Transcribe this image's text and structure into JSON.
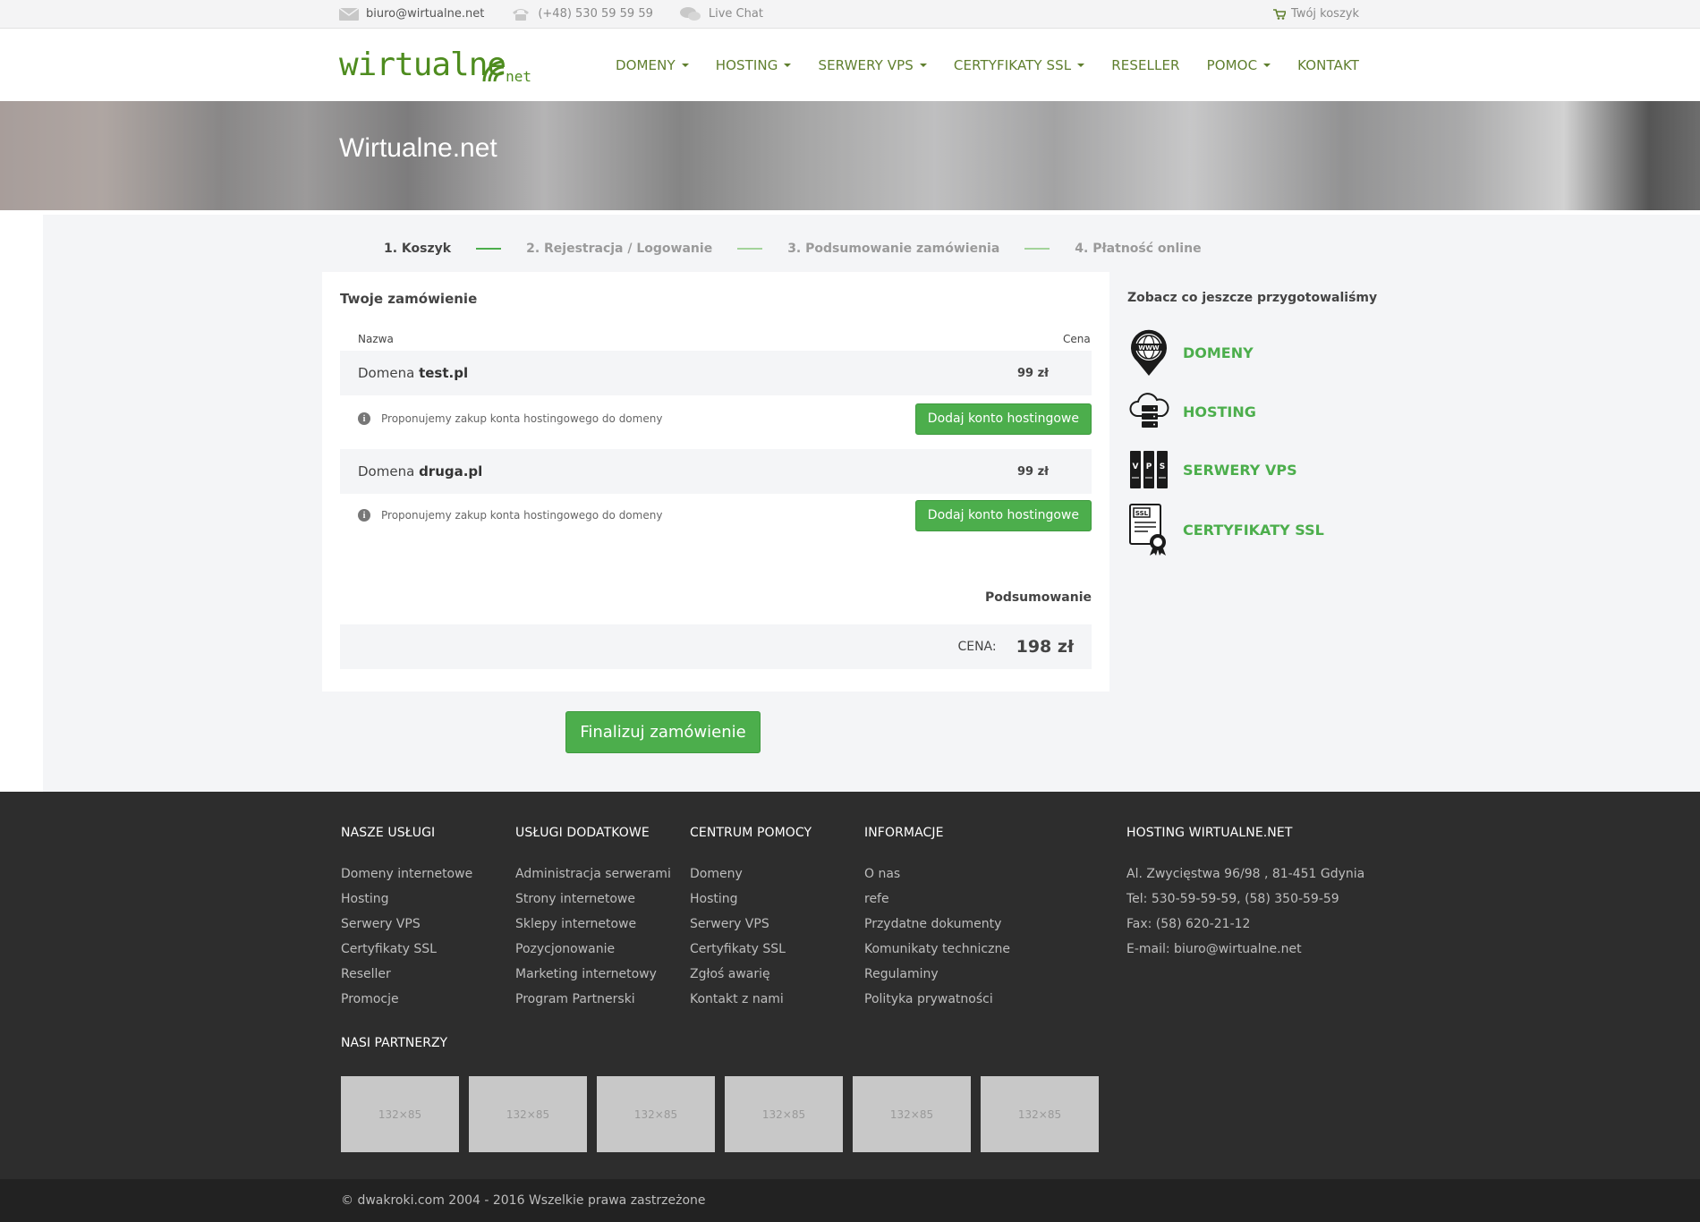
{
  "topbar": {
    "email": "biuro@wirtualne.net",
    "phone": "(+48) 530 59 59 59",
    "chat": "Live Chat",
    "cart": "Twój koszyk"
  },
  "header": {
    "logo_main": "wirtualne",
    "logo_sub": "net",
    "nav": [
      "DOMENY",
      "HOSTING",
      "SERWERY VPS",
      "CERTYFIKATY SSL",
      "RESELLER",
      "POMOC",
      "KONTAKT"
    ]
  },
  "hero": {
    "title": "Wirtualne.net"
  },
  "steps": [
    "1. Koszyk",
    "2. Rejestracja  / Logowanie",
    "3. Podsumowanie zamówienia",
    "4. Płatność online"
  ],
  "order": {
    "title": "Twoje zamówienie",
    "col_name": "Nazwa",
    "col_price": "Cena",
    "items": [
      {
        "prefix": "Domena",
        "domain": "test.pl",
        "price": "99 zł"
      },
      {
        "prefix": "Domena",
        "domain": "druga.pl",
        "price": "99 zł"
      }
    ],
    "suggestion_text": "Proponujemy zakup konta hostingowego do domeny",
    "suggestion_button": "Dodaj konto hostingowe",
    "summary_label": "Podsumowanie",
    "total_label": "CENA:",
    "total_value": "198 zł",
    "finalize_button": "Finalizuj zamówienie"
  },
  "sidebar": {
    "title": "Zobacz co jeszcze przygotowaliśmy",
    "items": [
      {
        "label": "DOMENY",
        "icon": "www-globe-icon"
      },
      {
        "label": "HOSTING",
        "icon": "cloud-server-icon"
      },
      {
        "label": "SERWERY VPS",
        "icon": "vps-server-icon"
      },
      {
        "label": "CERTYFIKATY SSL",
        "icon": "ssl-certificate-icon"
      }
    ]
  },
  "footer": {
    "col1": {
      "title": "NASZE USŁUGI",
      "items": [
        "Domeny internetowe",
        "Hosting",
        "Serwery VPS",
        "Certyfikaty SSL",
        "Reseller",
        "Promocje"
      ]
    },
    "col2": {
      "title": "USŁUGI DODATKOWE",
      "items": [
        "Administracja serwerami",
        "Strony internetowe",
        "Sklepy internetowe",
        "Pozycjonowanie",
        "Marketing internetowy",
        "Program Partnerski"
      ]
    },
    "col3": {
      "title": "CENTRUM POMOCY",
      "items": [
        "Domeny",
        "Hosting",
        "Serwery VPS",
        "Certyfikaty SSL",
        "Zgłoś awarię",
        "Kontakt z nami"
      ]
    },
    "col4": {
      "title": "INFORMACJE",
      "items": [
        "O nas",
        "refe",
        "Przydatne dokumenty",
        "Komunikaty techniczne",
        "Regulaminy",
        "Polityka prywatności"
      ]
    },
    "col5": {
      "title": "HOSTING WIRTUALNE.NET",
      "items": [
        "Al. Zwycięstwa 96/98 , 81-451 Gdynia",
        "Tel: 530-59-59-59, (58) 350-59-59",
        "Fax: (58) 620-21-12",
        "E-mail: biuro@wirtualne.net"
      ]
    },
    "partners_title": "NASI PARTNERZY",
    "partners": [
      "132×85",
      "132×85",
      "132×85",
      "132×85",
      "132×85",
      "132×85"
    ],
    "copyright": "© dwakroki.com 2004 - 2016 Wszelkie prawa zastrzeżone"
  },
  "colors": {
    "accent": "#4cae4c",
    "nav": "#5f7f2e",
    "footer_bg": "#2d2d2d"
  }
}
